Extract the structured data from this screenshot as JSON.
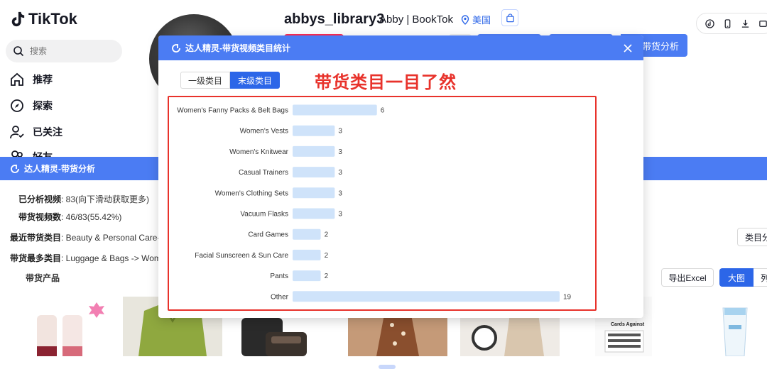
{
  "app": {
    "brand": "TikTok",
    "search_placeholder": "搜索",
    "nav": [
      {
        "label": "推荐",
        "icon": "home-icon"
      },
      {
        "label": "探索",
        "icon": "compass-icon"
      },
      {
        "label": "已关注",
        "icon": "following-icon"
      },
      {
        "label": "好友",
        "icon": "friends-icon"
      }
    ]
  },
  "profile": {
    "username": "abbys_library3",
    "display_name": "Abby | BookTok",
    "location": "美国",
    "analysis_button": "带货分析"
  },
  "analysis_panel": {
    "title": "达人精灵-带货分析",
    "lines": [
      {
        "label": "已分析视频",
        "value": ": 83(向下滑动获取更多)"
      },
      {
        "label": "带货视频数",
        "value": ": 46/83(55.42%)"
      },
      {
        "label": "最近带货类目",
        "value": ": Beauty & Personal Care->M"
      },
      {
        "label": "带货最多类目",
        "value": ": Luggage & Bags -> Women"
      }
    ],
    "products_label": "带货产品",
    "category_button": "类目分",
    "export_button": "导出Excel",
    "big_view_button": "大图",
    "list_view_button": "列",
    "product_card_text": "Cards Against"
  },
  "modal": {
    "title": "达人精灵-带货视频类目统计",
    "tabs": [
      {
        "label": "一级类目",
        "active": false
      },
      {
        "label": "末级类目",
        "active": true
      }
    ],
    "annotation": "带货类目一目了然"
  },
  "colors": {
    "accent": "#4b7cf3",
    "primary": "#2c66e8",
    "bar": "#cfe3fa",
    "annotation": "#e8322b",
    "tiktok_red": "#fe2c55"
  },
  "chart_data": {
    "type": "bar",
    "orientation": "horizontal",
    "categories": [
      "Women's Fanny Packs & Belt Bags",
      "Women's Vests",
      "Women's Knitwear",
      "Casual Trainers",
      "Women's Clothing Sets",
      "Vacuum Flasks",
      "Card Games",
      "Facial Sunscreen & Sun Care",
      "Pants",
      "Other"
    ],
    "values": [
      6,
      3,
      3,
      3,
      3,
      3,
      2,
      2,
      2,
      19
    ],
    "xlim": [
      0,
      19
    ],
    "grid": false,
    "legend": "none"
  }
}
